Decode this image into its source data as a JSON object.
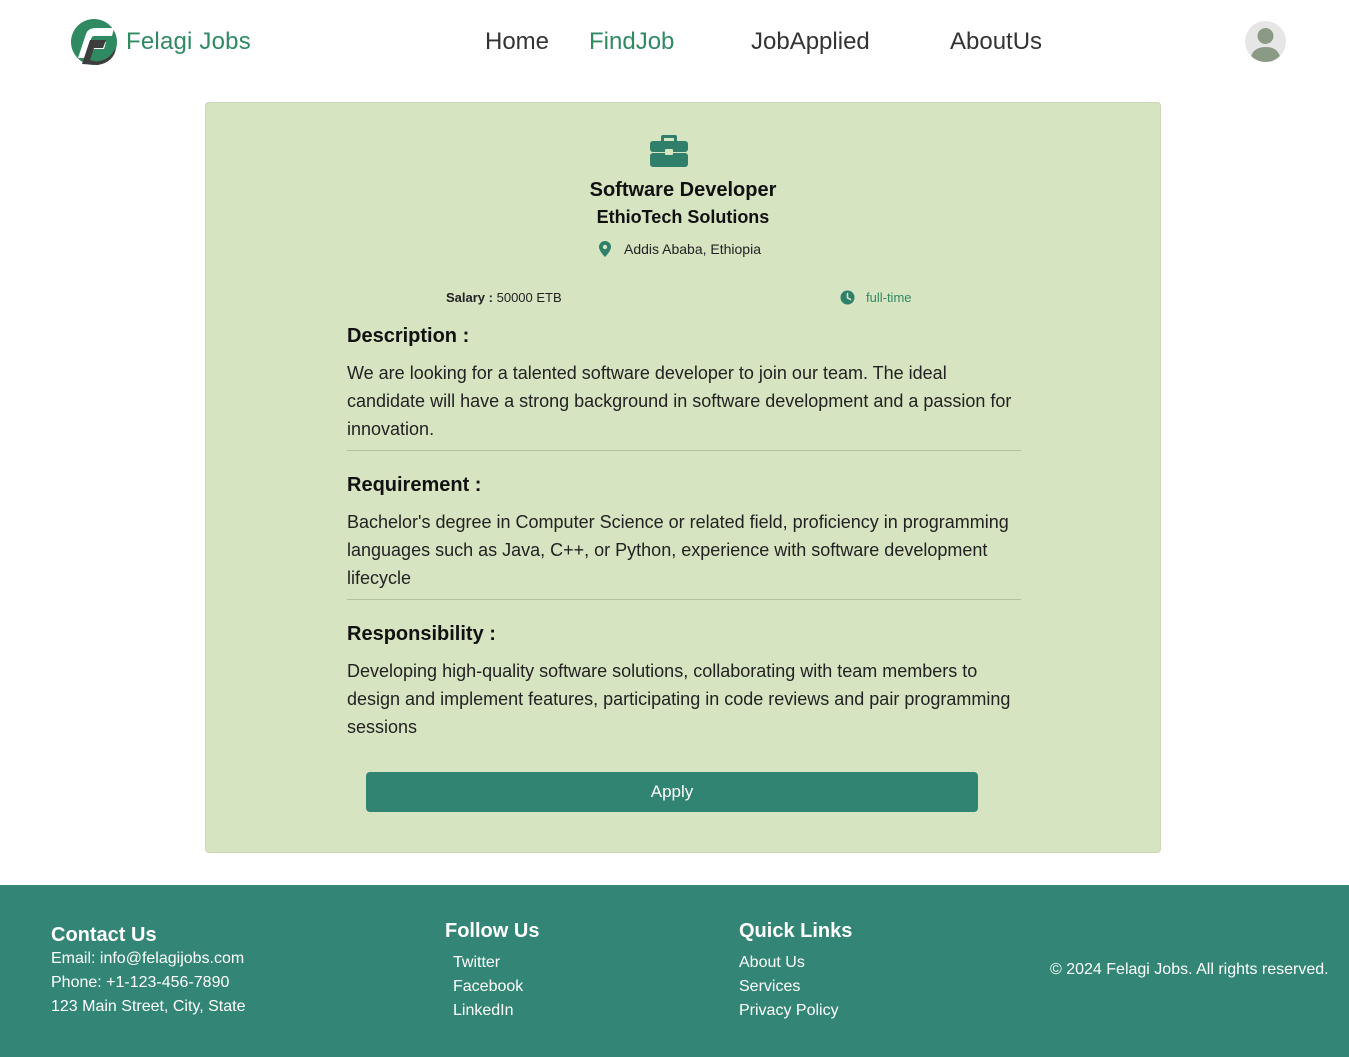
{
  "header": {
    "brand": "Felagi Jobs",
    "nav": [
      {
        "label": "Home"
      },
      {
        "label": "FindJob"
      },
      {
        "label": "JobApplied"
      },
      {
        "label": "AboutUs"
      }
    ]
  },
  "job": {
    "title": "Software Developer",
    "company": "EthioTech Solutions",
    "location": "Addis Ababa, Ethiopia",
    "salary_label": "Salary :",
    "salary_value": "50000 ETB",
    "job_type": "full-time",
    "sections": [
      {
        "heading": "Description :",
        "body": "We are looking for a talented software developer to join our team. The ideal candidate will have a strong background in software development and a passion for innovation."
      },
      {
        "heading": "Requirement :",
        "body": "Bachelor's degree in Computer Science or related field, proficiency in programming languages such as Java, C++, or Python, experience with software development lifecycle"
      },
      {
        "heading": "Responsibility :",
        "body": "Developing high-quality software solutions, collaborating with team members to design and implement features, participating in code reviews and pair programming sessions"
      }
    ],
    "apply_label": "Apply"
  },
  "footer": {
    "contact": {
      "heading": "Contact Us",
      "email": "Email: info@felagijobs.com",
      "phone": "Phone: +1-123-456-7890",
      "address": "123 Main Street, City, State"
    },
    "follow": {
      "heading": "Follow Us",
      "links": [
        "Twitter",
        "Facebook",
        "LinkedIn"
      ]
    },
    "quick": {
      "heading": "Quick Links",
      "links": [
        "About Us",
        "Services",
        "Privacy Policy"
      ]
    },
    "copyright": "© 2024 Felagi Jobs. All rights reserved."
  },
  "colors": {
    "brand_green": "#2f8a62",
    "card_bg": "#d6e4c1",
    "button_bg": "#328472",
    "footer_bg": "#338675"
  },
  "icons": [
    "logo-icon",
    "user-avatar-icon",
    "briefcase-icon",
    "location-pin-icon",
    "clock-icon"
  ]
}
